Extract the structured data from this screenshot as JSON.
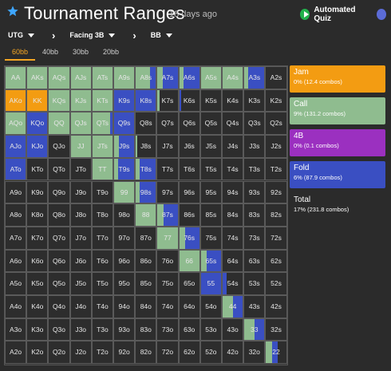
{
  "header": {
    "title": "Tournament Ranges",
    "updated": "18 days ago",
    "quiz_label": "Automated Quiz"
  },
  "nav": {
    "position": "UTG",
    "situation": "Facing 3B",
    "hero": "BB"
  },
  "tabs": [
    "60bb",
    "40bb",
    "30bb",
    "20bb"
  ],
  "active_tab": 0,
  "colors": {
    "jam": "#f39c12",
    "call": "#8fbc8f",
    "fourbet": "#9b30c0",
    "fold": "#3a4fc2",
    "empty": "#2d2d2d"
  },
  "legend": [
    {
      "name": "Jam",
      "combos": "0% (12.4 combos)",
      "color": "#f39c12"
    },
    {
      "name": "Call",
      "combos": "9% (131.2 combos)",
      "color": "#8fbc8f"
    },
    {
      "name": "4B",
      "combos": "0% (0.1 combos)",
      "color": "#9b30c0"
    },
    {
      "name": "Fold",
      "combos": "6% (87.9 combos)",
      "color": "#3a4fc2"
    },
    {
      "name": "Total",
      "combos": "17% (231.8 combos)",
      "color": ""
    }
  ],
  "grid": {
    "rows": [
      [
        "AA",
        "AKs",
        "AQs",
        "AJs",
        "ATs",
        "A9s",
        "A8s",
        "A7s",
        "A6s",
        "A5s",
        "A4s",
        "A3s",
        "A2s"
      ],
      [
        "AKo",
        "KK",
        "KQs",
        "KJs",
        "KTs",
        "K9s",
        "K8s",
        "K7s",
        "K6s",
        "K5s",
        "K4s",
        "K3s",
        "K2s"
      ],
      [
        "AQo",
        "KQo",
        "QQ",
        "QJs",
        "QTs",
        "Q9s",
        "Q8s",
        "Q7s",
        "Q6s",
        "Q5s",
        "Q4s",
        "Q3s",
        "Q2s"
      ],
      [
        "AJo",
        "KJo",
        "QJo",
        "JJ",
        "JTs",
        "J9s",
        "J8s",
        "J7s",
        "J6s",
        "J5s",
        "J4s",
        "J3s",
        "J2s"
      ],
      [
        "ATo",
        "KTo",
        "QTo",
        "JTo",
        "TT",
        "T9s",
        "T8s",
        "T7s",
        "T6s",
        "T5s",
        "T4s",
        "T3s",
        "T2s"
      ],
      [
        "A9o",
        "K9o",
        "Q9o",
        "J9o",
        "T9o",
        "99",
        "98s",
        "97s",
        "96s",
        "95s",
        "94s",
        "93s",
        "92s"
      ],
      [
        "A8o",
        "K8o",
        "Q8o",
        "J8o",
        "T8o",
        "98o",
        "88",
        "87s",
        "86s",
        "85s",
        "84s",
        "83s",
        "82s"
      ],
      [
        "A7o",
        "K7o",
        "Q7o",
        "J7o",
        "T7o",
        "97o",
        "87o",
        "77",
        "76s",
        "75s",
        "74s",
        "73s",
        "72s"
      ],
      [
        "A6o",
        "K6o",
        "Q6o",
        "J6o",
        "T6o",
        "96o",
        "86o",
        "76o",
        "66",
        "65s",
        "64s",
        "63s",
        "62s"
      ],
      [
        "A5o",
        "K5o",
        "Q5o",
        "J5o",
        "T5o",
        "95o",
        "85o",
        "75o",
        "65o",
        "55",
        "54s",
        "53s",
        "52s"
      ],
      [
        "A4o",
        "K4o",
        "Q4o",
        "J4o",
        "T4o",
        "94o",
        "84o",
        "74o",
        "64o",
        "54o",
        "44",
        "43s",
        "42s"
      ],
      [
        "A3o",
        "K3o",
        "Q3o",
        "J3o",
        "T3o",
        "93o",
        "83o",
        "73o",
        "63o",
        "53o",
        "43o",
        "33",
        "32s"
      ],
      [
        "A2o",
        "K2o",
        "Q2o",
        "J2o",
        "T2o",
        "92o",
        "82o",
        "72o",
        "62o",
        "52o",
        "42o",
        "32o",
        "22"
      ]
    ],
    "fills": {
      "AA": [
        [
          "call",
          1
        ]
      ],
      "AKs": [
        [
          "call",
          1
        ]
      ],
      "AQs": [
        [
          "call",
          1
        ]
      ],
      "AJs": [
        [
          "call",
          1
        ]
      ],
      "ATs": [
        [
          "call",
          1
        ]
      ],
      "A9s": [
        [
          "call",
          1
        ]
      ],
      "A8s": [
        [
          "call",
          0.7
        ],
        [
          "fold",
          0.3
        ]
      ],
      "A7s": [
        [
          "call",
          0.25
        ],
        [
          "fold",
          0.75
        ]
      ],
      "A6s": [
        [
          "call",
          0.2
        ],
        [
          "fold",
          0.8
        ]
      ],
      "A5s": [
        [
          "call",
          1
        ]
      ],
      "A4s": [
        [
          "call",
          1
        ]
      ],
      "A3s": [
        [
          "call",
          0.2
        ],
        [
          "fold",
          0.8
        ]
      ],
      "AKo": [
        [
          "jam",
          1
        ]
      ],
      "KK": [
        [
          "jam",
          1
        ]
      ],
      "KQs": [
        [
          "call",
          1
        ]
      ],
      "KJs": [
        [
          "call",
          1
        ]
      ],
      "KTs": [
        [
          "call",
          1
        ]
      ],
      "K9s": [
        [
          "fold",
          1
        ]
      ],
      "K8s": [
        [
          "fold",
          1
        ]
      ],
      "K7s": [
        [
          "call",
          0.1
        ]
      ],
      "K6s": [
        [
          "fold",
          0.08
        ]
      ],
      "AQo": [
        [
          "call",
          1
        ]
      ],
      "KQo": [
        [
          "fold",
          1
        ]
      ],
      "QQ": [
        [
          "call",
          1
        ]
      ],
      "QJs": [
        [
          "call",
          1
        ]
      ],
      "QTs": [
        [
          "call",
          0.9
        ],
        [
          "fold",
          0.1
        ]
      ],
      "Q9s": [
        [
          "fold",
          1
        ]
      ],
      "AJo": [
        [
          "fold",
          1
        ]
      ],
      "KJo": [
        [
          "fold",
          1
        ]
      ],
      "JJ": [
        [
          "call",
          1
        ]
      ],
      "JTs": [
        [
          "call",
          1
        ]
      ],
      "J9s": [
        [
          "call",
          0.25
        ],
        [
          "fold",
          0.75
        ]
      ],
      "J8s": [
        [
          "call",
          0.08
        ]
      ],
      "ATo": [
        [
          "fold",
          1
        ]
      ],
      "TT": [
        [
          "call",
          1
        ]
      ],
      "T9s": [
        [
          "call",
          0.2
        ],
        [
          "fold",
          0.8
        ]
      ],
      "T8s": [
        [
          "call",
          0.2
        ],
        [
          "fold",
          0.8
        ]
      ],
      "99": [
        [
          "call",
          1
        ]
      ],
      "98s": [
        [
          "call",
          0.2
        ],
        [
          "fold",
          0.8
        ]
      ],
      "88": [
        [
          "call",
          1
        ]
      ],
      "87s": [
        [
          "call",
          0.3
        ],
        [
          "fold",
          0.7
        ]
      ],
      "77": [
        [
          "call",
          1
        ]
      ],
      "76s": [
        [
          "call",
          0.3
        ],
        [
          "fold",
          0.7
        ]
      ],
      "66": [
        [
          "call",
          1
        ]
      ],
      "65s": [
        [
          "call",
          0.3
        ],
        [
          "fold",
          0.7
        ]
      ],
      "55": [
        [
          "fold",
          1
        ]
      ],
      "54s": [
        [
          "fold",
          0.2
        ]
      ],
      "44": [
        [
          "call",
          0.5
        ],
        [
          "fold",
          0.5
        ]
      ],
      "33": [
        [
          "call",
          0.5
        ],
        [
          "fold",
          0.5
        ]
      ],
      "22": [
        [
          "call",
          0.3
        ],
        [
          "fold",
          0.3
        ]
      ]
    }
  }
}
